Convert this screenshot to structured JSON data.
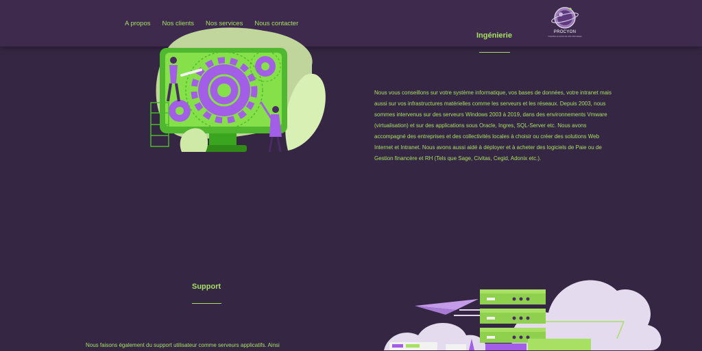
{
  "nav": {
    "items": [
      {
        "label": "A propos"
      },
      {
        "label": "Nos clients"
      },
      {
        "label": "Nos services"
      },
      {
        "label": "Nous contacter"
      }
    ]
  },
  "logo": {
    "name": "PROCYON",
    "tagline": "l'expertise au service de votre informatique"
  },
  "sections": {
    "ingenierie": {
      "title": "Ingénierie",
      "body": "Nous vous conseillons sur votre système informatique, vos bases de données, votre intranet mais aussi sur vos infrastructures matérielles comme les serveurs et les réseaux. Depuis 2003, nous sommes intervenus sur des serveurs Windows 2003 à 2019, dans des environnements Vmware (virtualisation) et sur des applications sous Oracle, Ingres, SQL-Server etc. Nous avons accompagné des entreprises et des collectivités locales à choisir ou créer des solutions Web Internet et Intranet. Nous avons aussi aidé à déployer et à acheter des logiciels de Paie ou de Gestion financère et RH (Tels que Sage, Civitas, Cegid, Adonix etc.)."
    },
    "support": {
      "title": "Support",
      "body": "Nous faisons également du support utilisateur comme serveurs applicatifs. Ainsi"
    }
  },
  "colors": {
    "background": "#352643",
    "header": "#3d2a4d",
    "accent": "#a8e063",
    "purple": "#a25ee6"
  }
}
